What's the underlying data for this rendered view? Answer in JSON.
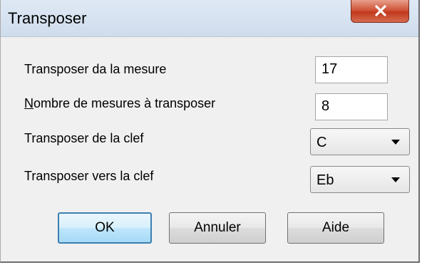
{
  "window": {
    "title": "Transposer",
    "close_glyph": "X"
  },
  "fields": {
    "start_measure": {
      "label": "Transposer da la mesure",
      "value": "17"
    },
    "measure_count": {
      "label_mnemonic": "N",
      "label_rest": "ombre de mesures à transposer",
      "value": "8"
    },
    "from_key": {
      "label": "Transposer de la clef",
      "value": "C"
    },
    "to_key": {
      "label": "Transposer vers la clef",
      "value": "Eb"
    }
  },
  "buttons": {
    "ok": "OK",
    "cancel": "Annuler",
    "help": "Aide"
  },
  "colors": {
    "close_button": "#c2391d",
    "default_button_border": "#3c7fb1",
    "dialog_background": "#f0f0f0",
    "titlebar": "#dfe9f5"
  },
  "icons": {
    "close": "close-icon",
    "dropdown": "chevron-down-icon"
  }
}
